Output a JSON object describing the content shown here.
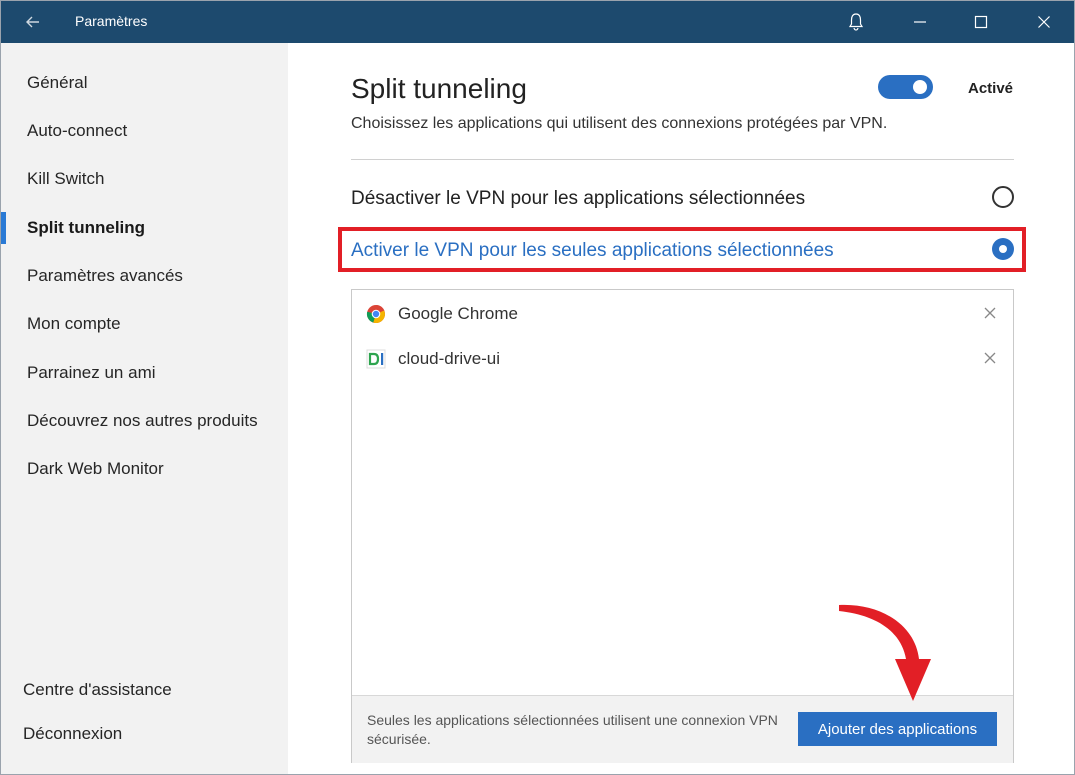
{
  "window": {
    "title": "Paramètres"
  },
  "sidebar": {
    "items": [
      {
        "label": "Général"
      },
      {
        "label": "Auto-connect"
      },
      {
        "label": "Kill Switch"
      },
      {
        "label": "Split tunneling",
        "active": true
      },
      {
        "label": "Paramètres avancés"
      },
      {
        "label": "Mon compte"
      },
      {
        "label": "Parrainez un ami"
      },
      {
        "label": "Découvrez nos autres produits"
      },
      {
        "label": "Dark Web Monitor"
      }
    ],
    "bottom": [
      {
        "label": "Centre d'assistance"
      },
      {
        "label": "Déconnexion"
      }
    ]
  },
  "main": {
    "title": "Split tunneling",
    "subtitle": "Choisissez les applications qui utilisent des connexions protégées par VPN.",
    "toggle": {
      "state": "on",
      "label": "Activé"
    },
    "options": [
      {
        "label": "Désactiver le VPN pour les applications sélectionnées",
        "selected": false
      },
      {
        "label": "Activer le VPN pour les seules applications sélectionnées",
        "selected": true
      }
    ],
    "apps": [
      {
        "name": "Google Chrome",
        "icon": "chrome-icon"
      },
      {
        "name": "cloud-drive-ui",
        "icon": "cloud-drive-icon"
      }
    ],
    "footer_note": "Seules les applications sélectionnées utilisent une connexion VPN sécurisée.",
    "add_button": "Ajouter des applications"
  },
  "colors": {
    "titlebar": "#1d4a6e",
    "accent": "#2a6fc2",
    "highlight": "#e21f26",
    "sidebar_bg": "#f2f2f2"
  }
}
